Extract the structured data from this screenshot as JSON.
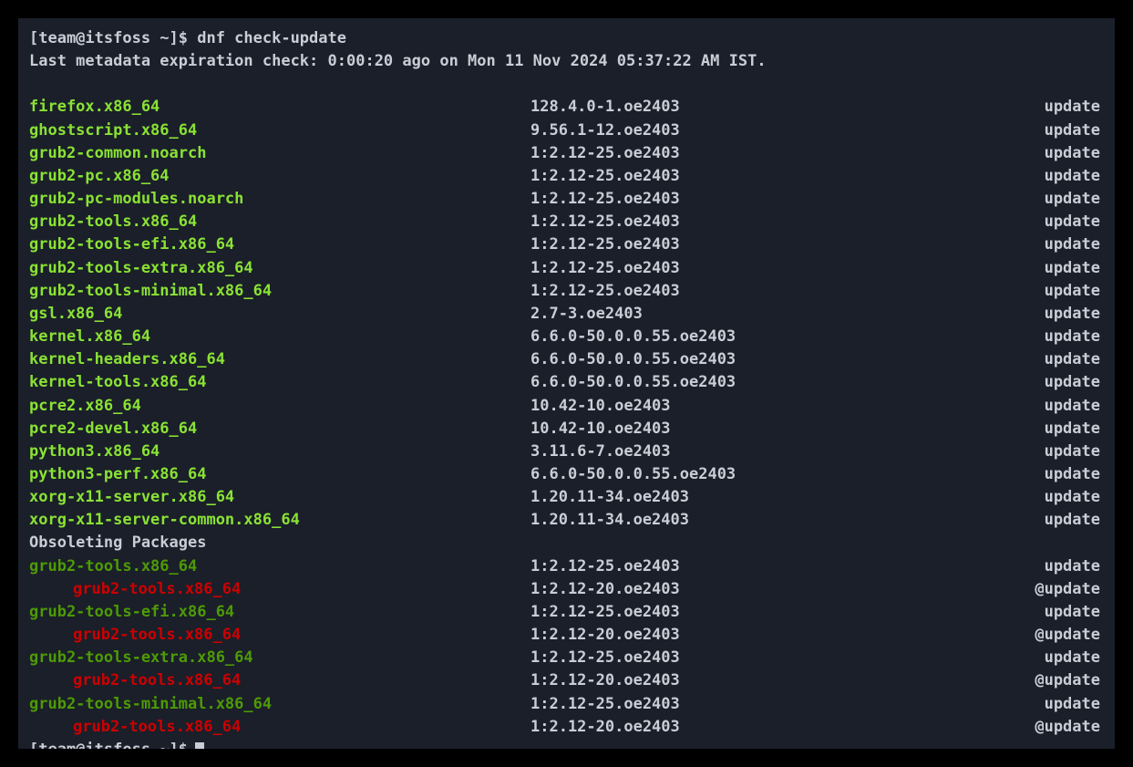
{
  "prompt": "[team@itsfoss ~]$ dnf check-update",
  "metadata": "Last metadata expiration check: 0:00:20 ago on Mon 11 Nov 2024 05:37:22 AM IST.",
  "packages": [
    {
      "name": "firefox.x86_64",
      "version": "128.4.0-1.oe2403",
      "repo": "update"
    },
    {
      "name": "ghostscript.x86_64",
      "version": "9.56.1-12.oe2403",
      "repo": "update"
    },
    {
      "name": "grub2-common.noarch",
      "version": "1:2.12-25.oe2403",
      "repo": "update"
    },
    {
      "name": "grub2-pc.x86_64",
      "version": "1:2.12-25.oe2403",
      "repo": "update"
    },
    {
      "name": "grub2-pc-modules.noarch",
      "version": "1:2.12-25.oe2403",
      "repo": "update"
    },
    {
      "name": "grub2-tools.x86_64",
      "version": "1:2.12-25.oe2403",
      "repo": "update"
    },
    {
      "name": "grub2-tools-efi.x86_64",
      "version": "1:2.12-25.oe2403",
      "repo": "update"
    },
    {
      "name": "grub2-tools-extra.x86_64",
      "version": "1:2.12-25.oe2403",
      "repo": "update"
    },
    {
      "name": "grub2-tools-minimal.x86_64",
      "version": "1:2.12-25.oe2403",
      "repo": "update"
    },
    {
      "name": "gsl.x86_64",
      "version": "2.7-3.oe2403",
      "repo": "update"
    },
    {
      "name": "kernel.x86_64",
      "version": "6.6.0-50.0.0.55.oe2403",
      "repo": "update"
    },
    {
      "name": "kernel-headers.x86_64",
      "version": "6.6.0-50.0.0.55.oe2403",
      "repo": "update"
    },
    {
      "name": "kernel-tools.x86_64",
      "version": "6.6.0-50.0.0.55.oe2403",
      "repo": "update"
    },
    {
      "name": "pcre2.x86_64",
      "version": "10.42-10.oe2403",
      "repo": "update"
    },
    {
      "name": "pcre2-devel.x86_64",
      "version": "10.42-10.oe2403",
      "repo": "update"
    },
    {
      "name": "python3.x86_64",
      "version": "3.11.6-7.oe2403",
      "repo": "update"
    },
    {
      "name": "python3-perf.x86_64",
      "version": "6.6.0-50.0.0.55.oe2403",
      "repo": "update"
    },
    {
      "name": "xorg-x11-server.x86_64",
      "version": "1.20.11-34.oe2403",
      "repo": "update"
    },
    {
      "name": "xorg-x11-server-common.x86_64",
      "version": "1.20.11-34.oe2403",
      "repo": "update"
    }
  ],
  "obsoleting_header": "Obsoleting Packages",
  "obsoleting": [
    {
      "name": "grub2-tools.x86_64",
      "version": "1:2.12-25.oe2403",
      "repo": "update",
      "type": "new"
    },
    {
      "name": "grub2-tools.x86_64",
      "version": "1:2.12-20.oe2403",
      "repo": "@update",
      "type": "old"
    },
    {
      "name": "grub2-tools-efi.x86_64",
      "version": "1:2.12-25.oe2403",
      "repo": "update",
      "type": "new"
    },
    {
      "name": "grub2-tools.x86_64",
      "version": "1:2.12-20.oe2403",
      "repo": "@update",
      "type": "old"
    },
    {
      "name": "grub2-tools-extra.x86_64",
      "version": "1:2.12-25.oe2403",
      "repo": "update",
      "type": "new"
    },
    {
      "name": "grub2-tools.x86_64",
      "version": "1:2.12-20.oe2403",
      "repo": "@update",
      "type": "old"
    },
    {
      "name": "grub2-tools-minimal.x86_64",
      "version": "1:2.12-25.oe2403",
      "repo": "update",
      "type": "new"
    },
    {
      "name": "grub2-tools.x86_64",
      "version": "1:2.12-20.oe2403",
      "repo": "@update",
      "type": "old"
    }
  ]
}
